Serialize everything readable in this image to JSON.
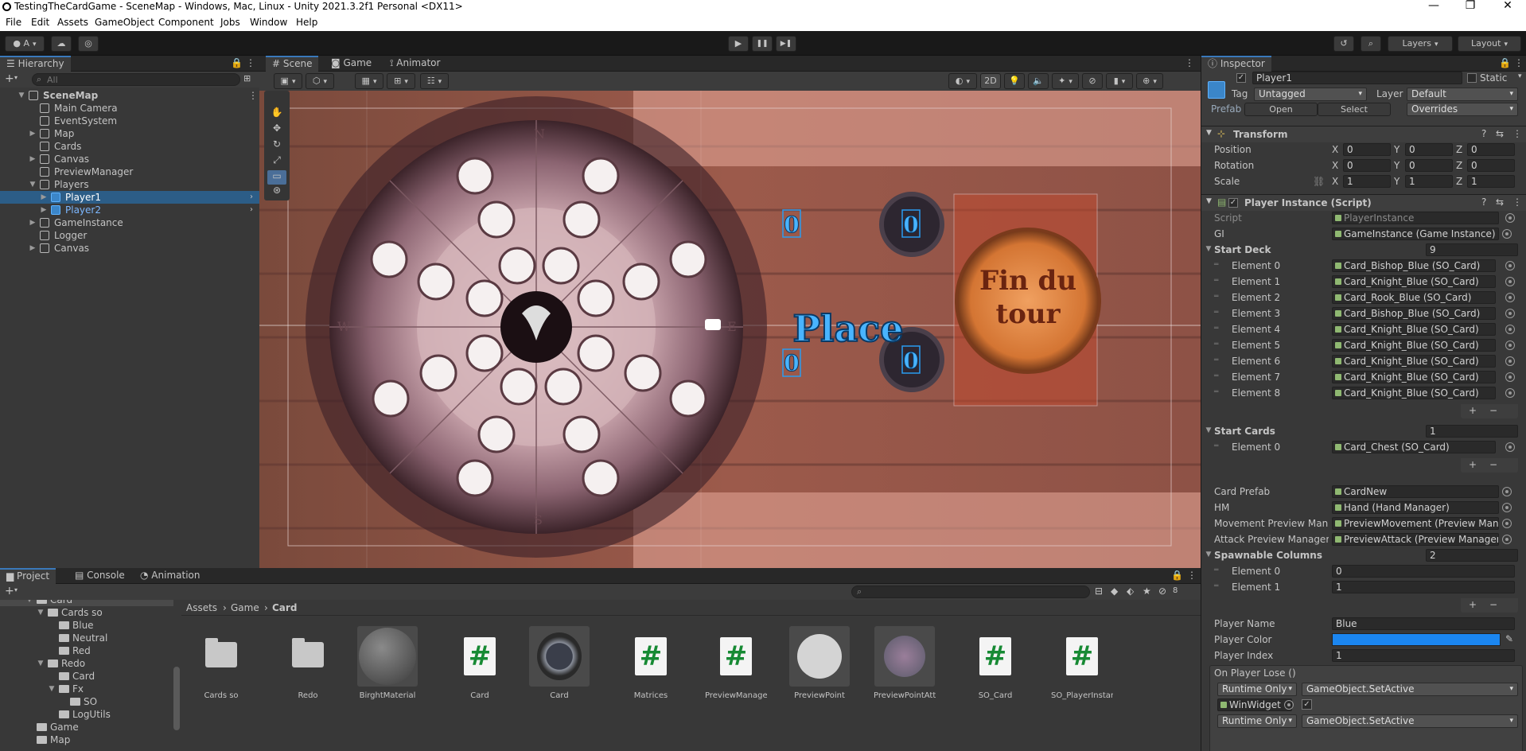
{
  "window": {
    "title": "TestingTheCardGame - SceneMap - Windows, Mac, Linux - Unity 2021.3.2f1 Personal <DX11>",
    "controls": [
      "—",
      "❐",
      "✕"
    ]
  },
  "menu": [
    "File",
    "Edit",
    "Assets",
    "GameObject",
    "Component",
    "Jobs",
    "Window",
    "Help"
  ],
  "toolbar": {
    "account": "A",
    "play": "▶",
    "pause": "❚❚",
    "step": "▶❚",
    "layers": "Layers",
    "layout": "Layout"
  },
  "hierarchy": {
    "tab": "Hierarchy",
    "search_placeholder": "All",
    "add": "+",
    "items": [
      {
        "label": "SceneMap",
        "indent": 0,
        "fold": "▼",
        "icon": "unity",
        "bold": true
      },
      {
        "label": "Main Camera",
        "indent": 1,
        "fold": "",
        "icon": "cube"
      },
      {
        "label": "EventSystem",
        "indent": 1,
        "fold": "",
        "icon": "cube"
      },
      {
        "label": "Map",
        "indent": 1,
        "fold": "▶",
        "icon": "cube"
      },
      {
        "label": "Cards",
        "indent": 1,
        "fold": "",
        "icon": "cube"
      },
      {
        "label": "Canvas",
        "indent": 1,
        "fold": "▶",
        "icon": "cube"
      },
      {
        "label": "PreviewManager",
        "indent": 1,
        "fold": "",
        "icon": "cube"
      },
      {
        "label": "Players",
        "indent": 1,
        "fold": "▼",
        "icon": "cube"
      },
      {
        "label": "Player1",
        "indent": 2,
        "fold": "▶",
        "icon": "prefab",
        "selected": true
      },
      {
        "label": "Player2",
        "indent": 2,
        "fold": "▶",
        "icon": "prefab",
        "blue": true
      },
      {
        "label": "GameInstance",
        "indent": 1,
        "fold": "▶",
        "icon": "cube"
      },
      {
        "label": "Logger",
        "indent": 1,
        "fold": "",
        "icon": "cube"
      },
      {
        "label": "Canvas",
        "indent": 1,
        "fold": "▶",
        "icon": "cube"
      }
    ]
  },
  "scene_tabs": [
    "Scene",
    "Game",
    "Animator"
  ],
  "scene_toolbar": {
    "mode_2d": "2D"
  },
  "scene": {
    "place_text": "Place",
    "end_turn_line1": "Fin du",
    "end_turn_line2": "tour",
    "counter": "0",
    "compass": [
      "N",
      "W",
      "E",
      "S"
    ]
  },
  "project": {
    "tabs": [
      "Project",
      "Console",
      "Animation"
    ],
    "add": "+",
    "badge": "8",
    "breadcrumb": [
      "Assets",
      "Game",
      "Card"
    ],
    "tree": [
      {
        "label": "Card",
        "indent": 0,
        "fold": "▼"
      },
      {
        "label": "Cards so",
        "indent": 1,
        "fold": "▼"
      },
      {
        "label": "Blue",
        "indent": 2,
        "fold": ""
      },
      {
        "label": "Neutral",
        "indent": 2,
        "fold": ""
      },
      {
        "label": "Red",
        "indent": 2,
        "fold": ""
      },
      {
        "label": "Redo",
        "indent": 1,
        "fold": "▼"
      },
      {
        "label": "Card",
        "indent": 2,
        "fold": ""
      },
      {
        "label": "Fx",
        "indent": 2,
        "fold": "▼"
      },
      {
        "label": "SO",
        "indent": 3,
        "fold": ""
      },
      {
        "label": "LogUtils",
        "indent": 2,
        "fold": ""
      },
      {
        "label": "Game",
        "indent": 0,
        "fold": ""
      },
      {
        "label": "Map",
        "indent": 0,
        "fold": ""
      }
    ],
    "assets": [
      {
        "name": "Cards so",
        "kind": "folder"
      },
      {
        "name": "Redo",
        "kind": "folder"
      },
      {
        "name": "BirghtMaterial",
        "kind": "material"
      },
      {
        "name": "Card",
        "kind": "script"
      },
      {
        "name": "Card",
        "kind": "prefab"
      },
      {
        "name": "Matrices",
        "kind": "script"
      },
      {
        "name": "PreviewManager",
        "kind": "script"
      },
      {
        "name": "PreviewPoint",
        "kind": "sphere"
      },
      {
        "name": "PreviewPointAtta...",
        "kind": "prefab2"
      },
      {
        "name": "SO_Card",
        "kind": "script"
      },
      {
        "name": "SO_PlayerInstan...",
        "kind": "script"
      }
    ]
  },
  "inspector": {
    "tab": "Inspector",
    "name": "Player1",
    "static": "Static",
    "tag_label": "Tag",
    "tag": "Untagged",
    "layer_label": "Layer",
    "layer": "Default",
    "prefab_label": "Prefab",
    "open": "Open",
    "select": "Select",
    "overrides": "Overrides",
    "transform": {
      "title": "Transform",
      "rows": [
        {
          "label": "Position",
          "x": "0",
          "y": "0",
          "z": "0"
        },
        {
          "label": "Rotation",
          "x": "0",
          "y": "0",
          "z": "0"
        },
        {
          "label": "Scale",
          "x": "1",
          "y": "1",
          "z": "1"
        }
      ]
    },
    "script_comp": {
      "title": "Player Instance (Script)",
      "script_label": "Script",
      "script": "PlayerInstance",
      "gi_label": "GI",
      "gi": "GameInstance (Game Instance)",
      "start_deck": {
        "label": "Start Deck",
        "count": "9",
        "elements": [
          {
            "label": "Element 0",
            "value": "Card_Bishop_Blue (SO_Card)"
          },
          {
            "label": "Element 1",
            "value": "Card_Knight_Blue (SO_Card)"
          },
          {
            "label": "Element 2",
            "value": "Card_Rook_Blue (SO_Card)"
          },
          {
            "label": "Element 3",
            "value": "Card_Bishop_Blue (SO_Card)"
          },
          {
            "label": "Element 4",
            "value": "Card_Knight_Blue (SO_Card)"
          },
          {
            "label": "Element 5",
            "value": "Card_Knight_Blue (SO_Card)"
          },
          {
            "label": "Element 6",
            "value": "Card_Knight_Blue (SO_Card)"
          },
          {
            "label": "Element 7",
            "value": "Card_Knight_Blue (SO_Card)"
          },
          {
            "label": "Element 8",
            "value": "Card_Knight_Blue (SO_Card)"
          }
        ]
      },
      "start_cards": {
        "label": "Start Cards",
        "count": "1",
        "elements": [
          {
            "label": "Element 0",
            "value": "Card_Chest (SO_Card)"
          }
        ]
      },
      "card_prefab_label": "Card Prefab",
      "card_prefab": "CardNew",
      "hm_label": "HM",
      "hm": "Hand (Hand Manager)",
      "move_label": "Movement Preview Mana",
      "move": "PreviewMovement (Preview Mana",
      "attack_label": "Attack Preview Manager",
      "attack": "PreviewAttack (Preview Manager",
      "spawn": {
        "label": "Spawnable Columns",
        "count": "2",
        "elements": [
          {
            "label": "Element 0",
            "value": "0"
          },
          {
            "label": "Element 1",
            "value": "1"
          }
        ]
      },
      "player_name_label": "Player Name",
      "player_name": "Blue",
      "player_color_label": "Player Color",
      "player_color": "#1b86f0",
      "player_index_label": "Player Index",
      "player_index": "1",
      "on_lose": "On Player Lose ()",
      "event1_mode": "Runtime Only",
      "event1_fn": "GameObject.SetActive",
      "event1_obj": "WinWidget",
      "event2_mode": "Runtime Only",
      "event2_fn": "GameObject.SetActive",
      "plus": "+",
      "minus": "−"
    }
  }
}
